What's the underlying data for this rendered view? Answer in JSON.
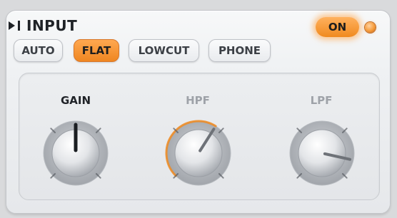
{
  "header": {
    "title": "INPUT"
  },
  "power": {
    "label": "ON",
    "state": "on"
  },
  "modes": [
    {
      "label": "AUTO",
      "active": false
    },
    {
      "label": "FLAT",
      "active": true
    },
    {
      "label": "LOWCUT",
      "active": false
    },
    {
      "label": "PHONE",
      "active": false
    }
  ],
  "knobs": [
    {
      "label": "GAIN",
      "active": true,
      "value": 0.5
    },
    {
      "label": "HPF",
      "active": false,
      "value": 0.62
    },
    {
      "label": "LPF",
      "active": false,
      "value": 0.88
    }
  ],
  "colors": {
    "accent": "#f08a1f",
    "label_active": "#1f2227",
    "label_inactive": "#9ea2a8"
  }
}
